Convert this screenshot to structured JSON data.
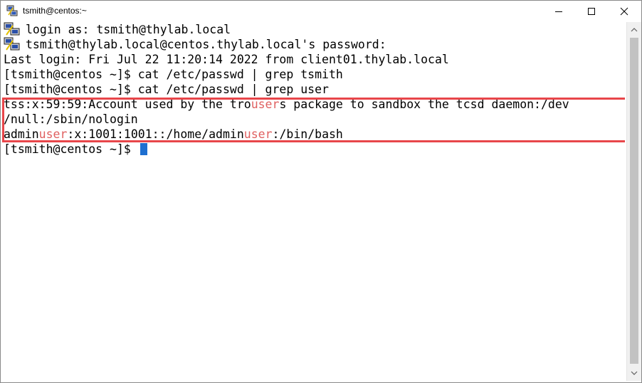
{
  "window": {
    "title": "tsmith@centos:~"
  },
  "terminal": {
    "lines": [
      "login as: tsmith@thylab.local",
      "tsmith@thylab.local@centos.thylab.local's password:",
      "Last login: Fri Jul 22 11:20:14 2022 from client01.thylab.local",
      "[tsmith@centos ~]$ cat /etc/passwd | grep tsmith",
      "[tsmith@centos ~]$ cat /etc/passwd | grep user"
    ],
    "result_1": {
      "before": "tss:x:59:59:Account used by the tro",
      "match": "user",
      "after": "s package to sandbox the tcsd daemon:/dev"
    },
    "result_1_wrap": "/null:/sbin/nologin",
    "result_2": {
      "part1": "admin",
      "match1": "user",
      "part2": ":x:1001:1001::/home/admin",
      "match2": "user",
      "part3": ":/bin/bash"
    },
    "prompt": "[tsmith@centos ~]$ "
  },
  "colors": {
    "match_highlight": "#e06060",
    "annotation_box": "#e8464a",
    "cursor": "#1e6fd0"
  },
  "icons": {
    "app": "putty-icon",
    "minimize": "minimize-icon",
    "maximize": "maximize-icon",
    "close": "close-icon"
  }
}
